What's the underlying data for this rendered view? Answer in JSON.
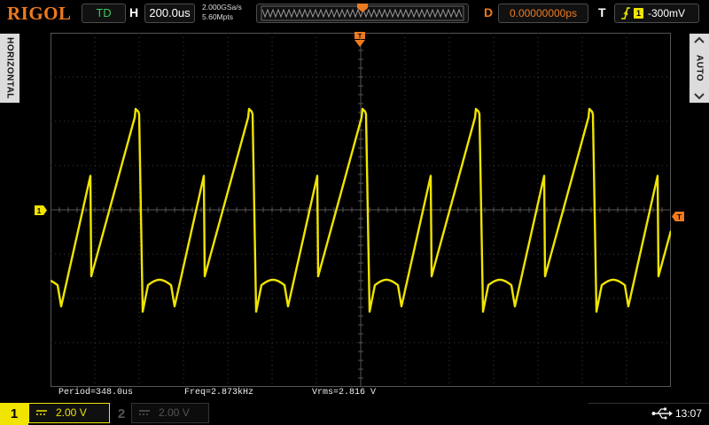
{
  "brand": {
    "logo": "RIGOL",
    "color": "#ee7a1f"
  },
  "topbar": {
    "run_state": "TD",
    "horizontal_label": "H",
    "timebase": "200.0us",
    "sample_rate": "2.000GSa/s",
    "memory_depth": "5.60Mpts",
    "delay_label": "D",
    "delay_value": "0.00000000ps",
    "trigger_label": "T",
    "trigger_source": "1",
    "trigger_level": "-300mV",
    "trigger_marker": "T"
  },
  "side": {
    "left_menu": "HORIZONTAL",
    "right_menu": "AUTO"
  },
  "markers": {
    "ch1": "1",
    "trigger_level": "T",
    "trigger_position": "T"
  },
  "measurements": {
    "period": "Period=348.0us",
    "freq": "Freq=2.873kHz",
    "vrms": "Vrms=2.816 V"
  },
  "channels": [
    {
      "number": "1",
      "scale": "2.00 V",
      "active": true,
      "color": "#f0e400"
    },
    {
      "number": "2",
      "scale": "2.00 V",
      "active": false,
      "color": "#555555"
    }
  ],
  "status": {
    "time": "13:07",
    "usb_icon": "usb-icon"
  },
  "colors": {
    "trace": "#f0e400",
    "accent": "#ee7a1f",
    "run": "#38c85a",
    "grid": "#3c3c3c"
  }
}
